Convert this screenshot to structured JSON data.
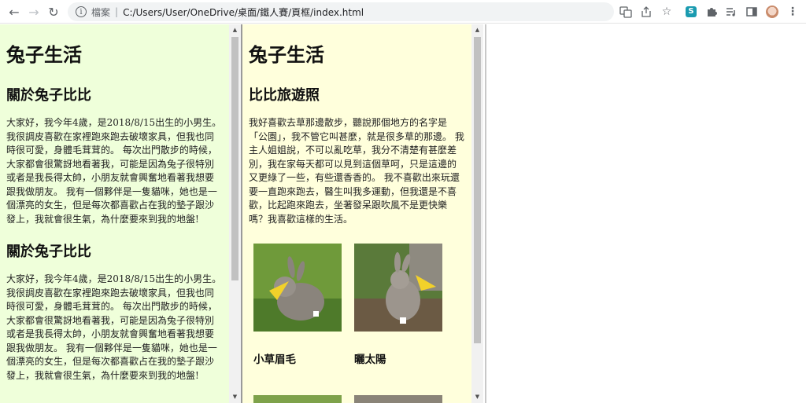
{
  "browser": {
    "back_icon": "back-arrow-icon",
    "forward_icon": "forward-arrow-icon",
    "reload_icon": "reload-icon",
    "scheme_label": "檔案",
    "url": "C:/Users/User/OneDrive/桌面/鐵人賽/頁框/index.html",
    "extension_badge": "S"
  },
  "frame_left": {
    "site_title": "兔子生活",
    "sections": [
      {
        "heading": "關於兔子比比",
        "text": "大家好，我今年4歲，是2018/8/15出生的小男生。我很調皮喜歡在家裡跑來跑去破壞家具，但我也同時很可愛，身體毛茸茸的。 每次出門散步的時候，大家都會很驚訝地看著我，可能是因為兔子很特別或者是我長得太帥，小朋友就會興奮地看著我想要跟我做朋友。 我有一個夥伴是一隻貓咪，她也是一個漂亮的女生，但是每次都喜歡占在我的墊子跟沙發上，我就會很生氣，為什麼要來到我的地盤!"
      },
      {
        "heading": "關於兔子比比",
        "text": "大家好，我今年4歲，是2018/8/15出生的小男生。我很調皮喜歡在家裡跑來跑去破壞家具，但我也同時很可愛，身體毛茸茸的。 每次出門散步的時候，大家都會很驚訝地看著我，可能是因為兔子很特別或者是我長得太帥，小朋友就會興奮地看著我想要跟我做朋友。 我有一個夥伴是一隻貓咪，她也是一個漂亮的女生，但是每次都喜歡占在我的墊子跟沙發上，我就會很生氣，為什麼要來到我的地盤!"
      }
    ]
  },
  "frame_middle": {
    "site_title": "兔子生活",
    "heading": "比比旅遊照",
    "text": "我好喜歡去草那邊散步，聽說那個地方的名字是「公園」，我不管它叫甚麼，就是很多草的那邊。 我主人姐姐說，不可以亂吃草，我分不清楚有甚麼差別，我在家每天都可以見到這個草呵，只是這邊的又更綠了一些，有些還香香的。 我不喜歡出來玩還要一直跑來跑去，醫生叫我多運動，但我還是不喜歡，比起跑來跑去，坐著發呆跟吹風不是更快樂嗎？我喜歡這樣的生活。",
    "photos": [
      {
        "title": "小草眉毛"
      },
      {
        "title": "曬太陽"
      }
    ]
  },
  "colors": {
    "frame_left_bg": "#efffda",
    "frame_middle_bg": "#ffffdc"
  }
}
